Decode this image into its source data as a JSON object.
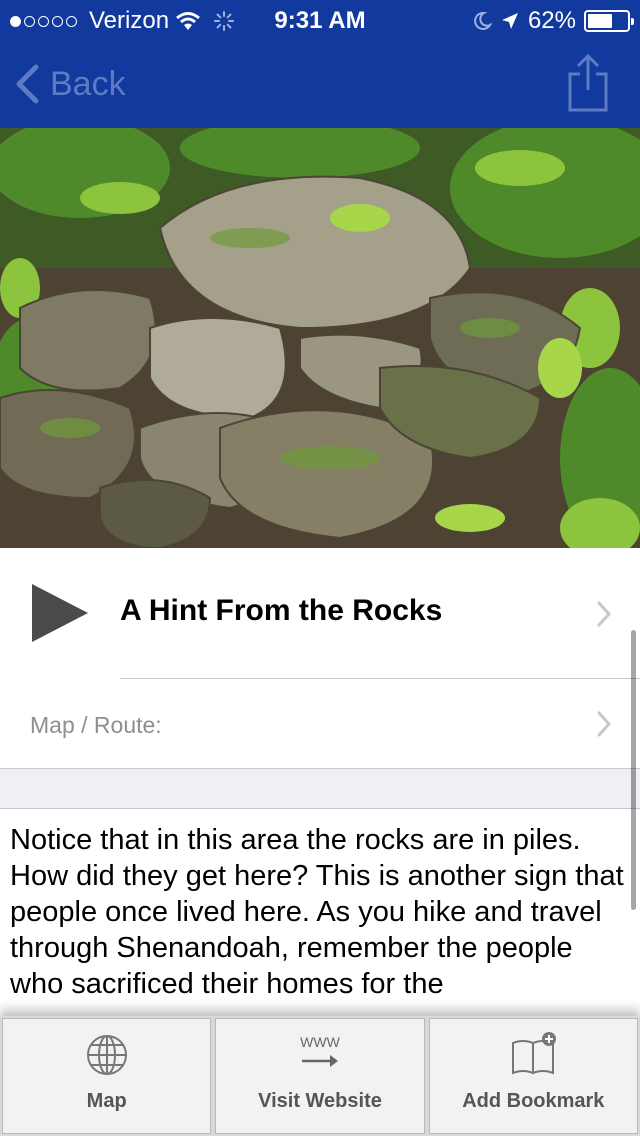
{
  "status_bar": {
    "carrier": "Verizon",
    "time": "9:31 AM",
    "battery": "62%",
    "battery_level": 0.62,
    "signal_bars_filled": 1,
    "signal_bars_total": 5
  },
  "nav": {
    "back_label": "Back",
    "back_icon": "chevron-left-icon",
    "share_icon": "share-icon",
    "bar_color": "#12399e"
  },
  "hero": {
    "image_icon": "rock-pile-photo"
  },
  "stop": {
    "title": "A Hint From the Rocks",
    "play_icon": "play-icon"
  },
  "map_row": {
    "label": "Map / Route:"
  },
  "description": {
    "text": "Notice that in this area the rocks are in piles. How did they get here? This is another sign that people once lived here. As you hike and travel through Shenandoah, remember the people who sacrificed their homes for the"
  },
  "toolbar": {
    "map_label": "Map",
    "website_label": "Visit Website",
    "website_icon_text": "WWW",
    "bookmark_label": "Add Bookmark"
  }
}
